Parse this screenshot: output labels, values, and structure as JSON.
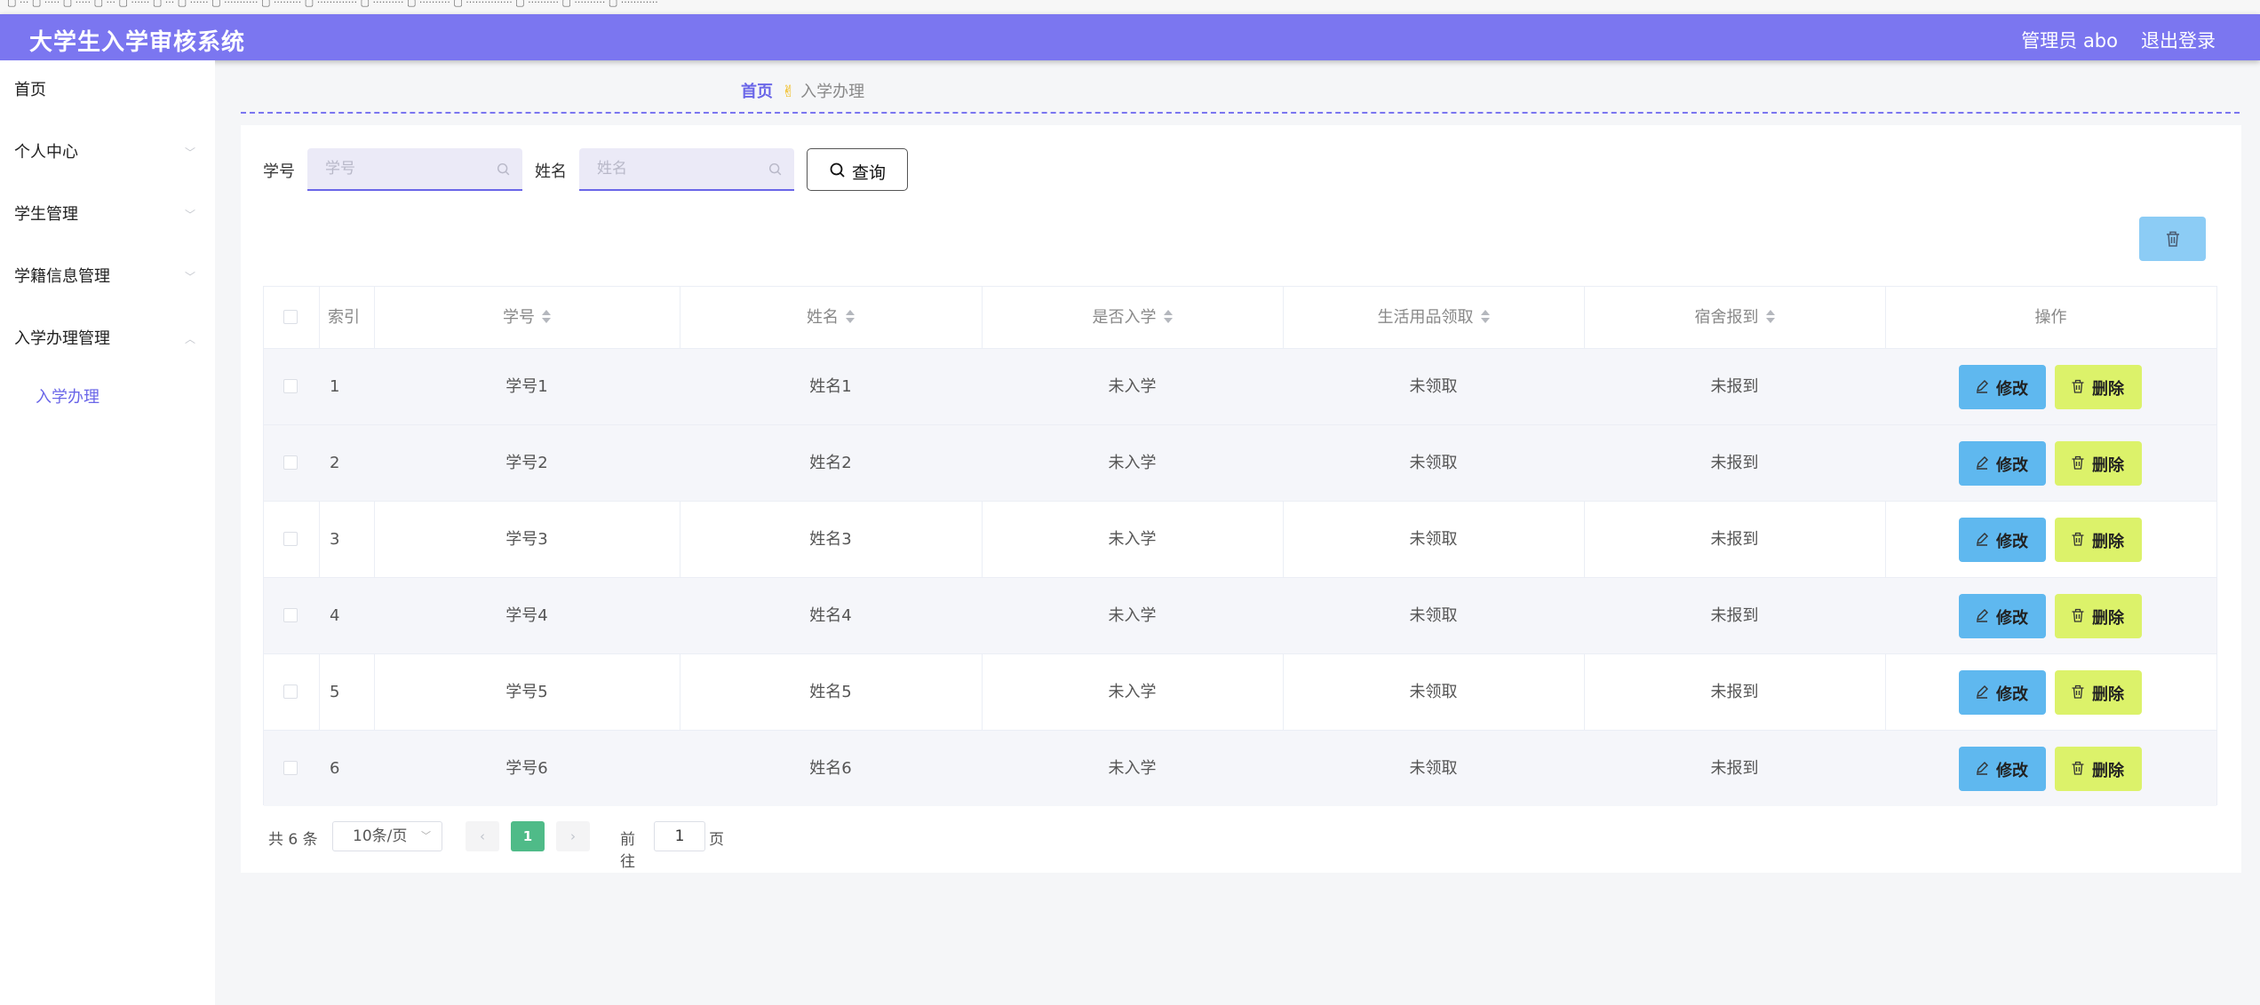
{
  "app": {
    "title": "大学生入学审核系统",
    "admin_label": "管理员 abo",
    "logout_label": "退出登录"
  },
  "sidebar": {
    "items": [
      {
        "label": "首页"
      },
      {
        "label": "个人中心"
      },
      {
        "label": "学生管理"
      },
      {
        "label": "学籍信息管理"
      },
      {
        "label": "入学办理管理"
      }
    ],
    "subitem": {
      "label": "入学办理"
    }
  },
  "breadcrumb": {
    "home": "首页",
    "separator": "✌",
    "current": "入学办理"
  },
  "search": {
    "student_id_label": "学号",
    "student_id_placeholder": "学号",
    "student_id_value": "",
    "name_label": "姓名",
    "name_placeholder": "姓名",
    "name_value": "",
    "query_label": "查询"
  },
  "table": {
    "headers": {
      "index": "索引",
      "student_id": "学号",
      "name": "姓名",
      "enrolled": "是否入学",
      "supplies": "生活用品领取",
      "dorm": "宿舍报到",
      "actions": "操作"
    },
    "edit_label": "修改",
    "delete_label": "删除",
    "rows": [
      {
        "index": "1",
        "student_id": "学号1",
        "name": "姓名1",
        "enrolled": "未入学",
        "supplies": "未领取",
        "dorm": "未报到"
      },
      {
        "index": "2",
        "student_id": "学号2",
        "name": "姓名2",
        "enrolled": "未入学",
        "supplies": "未领取",
        "dorm": "未报到"
      },
      {
        "index": "3",
        "student_id": "学号3",
        "name": "姓名3",
        "enrolled": "未入学",
        "supplies": "未领取",
        "dorm": "未报到"
      },
      {
        "index": "4",
        "student_id": "学号4",
        "name": "姓名4",
        "enrolled": "未入学",
        "supplies": "未领取",
        "dorm": "未报到"
      },
      {
        "index": "5",
        "student_id": "学号5",
        "name": "姓名5",
        "enrolled": "未入学",
        "supplies": "未领取",
        "dorm": "未报到"
      },
      {
        "index": "6",
        "student_id": "学号6",
        "name": "姓名6",
        "enrolled": "未入学",
        "supplies": "未领取",
        "dorm": "未报到"
      }
    ]
  },
  "pagination": {
    "total_label": "共 6 条",
    "page_size": "10条/页",
    "prev": "‹",
    "current_page": "1",
    "next": "›",
    "goto_label": "前往",
    "goto_value": "1",
    "page_unit": "页"
  },
  "colors": {
    "header_bg": "#7b76f0",
    "accent": "#6a66e8",
    "edit_button": "#5fb8ef",
    "delete_button": "#dcf26a",
    "active_page": "#4fbb88"
  },
  "icons": {
    "search": "search-icon",
    "trash": "trash-icon",
    "edit": "edit-icon",
    "chevron": "chevron-down-icon"
  }
}
